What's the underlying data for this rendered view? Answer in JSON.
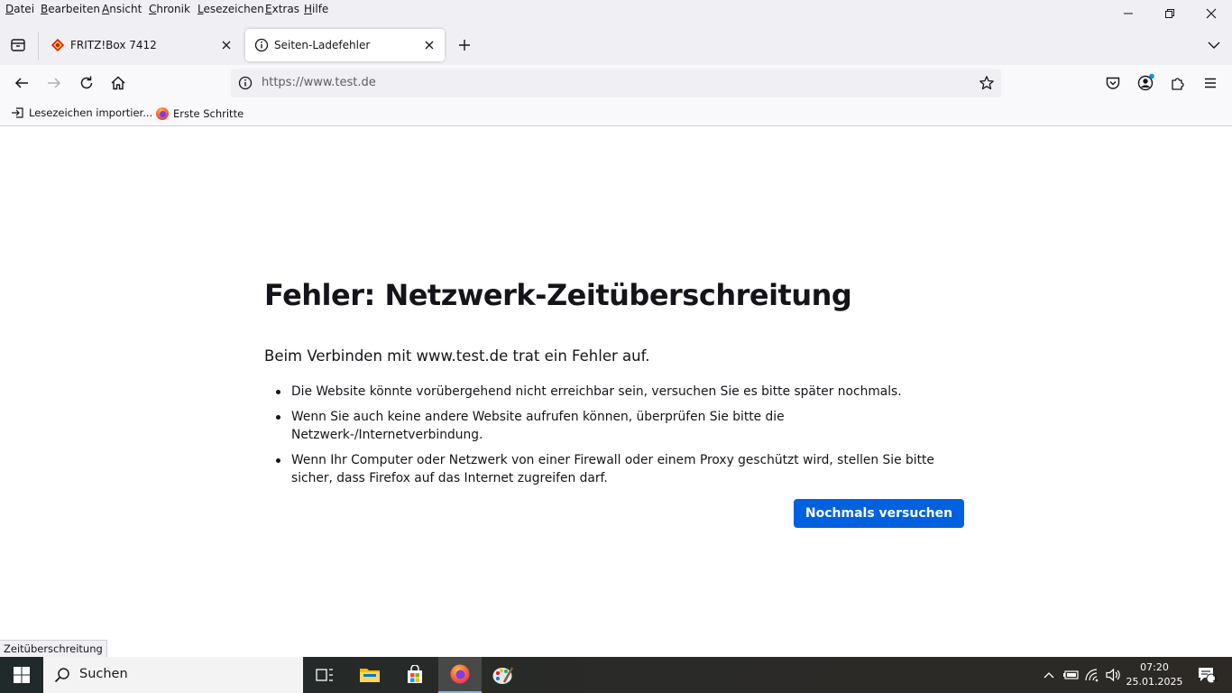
{
  "menubar": {
    "items": [
      {
        "label_u": "D",
        "label_rest": "atei"
      },
      {
        "label_u": "B",
        "label_rest": "earbeiten"
      },
      {
        "label_u": "A",
        "label_rest": "nsicht"
      },
      {
        "label_u": "C",
        "label_rest": "hronik"
      },
      {
        "label_u": "L",
        "label_rest": "esezeichen"
      },
      {
        "label_u": "E",
        "label_rest": "xtras"
      },
      {
        "label_u": "H",
        "label_rest": "ilfe"
      }
    ]
  },
  "tabs": [
    {
      "title": "FRITZ!Box 7412",
      "active": false
    },
    {
      "title": "Seiten-Ladefehler",
      "active": true
    }
  ],
  "navbar": {
    "url": "https://www.test.de"
  },
  "bookmarks": [
    {
      "label": "Lesezeichen importier..."
    },
    {
      "label": "Erste Schritte"
    }
  ],
  "error_page": {
    "title": "Fehler: Netzwerk-Zeitüberschreitung",
    "lead": "Beim Verbinden mit www.test.de trat ein Fehler auf.",
    "bullets": [
      "Die Website könnte vorübergehend nicht erreichbar sein, versuchen Sie es bitte später nochmals.",
      "Wenn Sie auch keine andere Website aufrufen können, überprüfen Sie bitte die Netzwerk-/Internetverbindung.",
      "Wenn Ihr Computer oder Netzwerk von einer Firewall oder einem Proxy geschützt wird, stellen Sie bitte sicher, dass Firefox auf das Internet zugreifen darf."
    ],
    "retry_label": "Nochmals versuchen"
  },
  "status_text": "Zeitüberschreitung",
  "taskbar": {
    "search_label": "Suchen",
    "time": "07:20",
    "date": "25.01.2025",
    "notification_count": "1"
  },
  "colors": {
    "accent": "#0061e0",
    "chrome_bg": "#f0f0f4",
    "toolbar_bg": "#f9f9fb"
  }
}
